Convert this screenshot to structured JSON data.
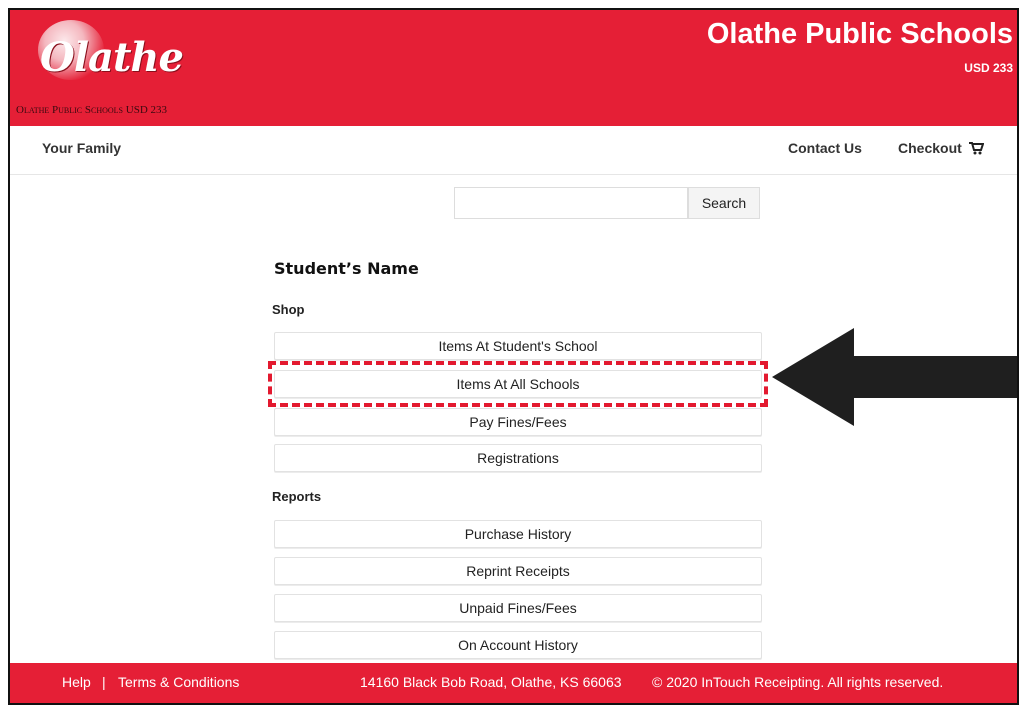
{
  "header": {
    "logo_text": "Olathe",
    "logo_subtitle": "Olathe Public Schools USD 233",
    "title": "Olathe Public Schools",
    "subtitle": "USD 233"
  },
  "nav": {
    "left": "Your Family",
    "contact": "Contact Us",
    "checkout": "Checkout"
  },
  "search": {
    "placeholder": "",
    "button": "Search"
  },
  "main": {
    "student_name": "Student’s Name",
    "shop_label": "Shop",
    "shop_items": [
      "Items At Student's School",
      "Items At All Schools",
      "Pay Fines/Fees",
      "Registrations"
    ],
    "reports_label": "Reports",
    "report_items": [
      "Purchase History",
      "Reprint Receipts",
      "Unpaid Fines/Fees",
      "On Account History"
    ]
  },
  "footer": {
    "help": "Help",
    "separator": "|",
    "terms": "Terms & Conditions",
    "address": "14160 Black Bob Road, Olathe, KS 66063",
    "copyright": "© 2020 InTouch Receipting. All rights reserved."
  },
  "colors": {
    "brand_red": "#e51f36",
    "highlight_dash": "#e3192f",
    "arrow": "#1f1f1f"
  },
  "icons": {
    "cart": "shopping-cart-icon",
    "arrow": "left-arrow-pointer-icon",
    "logo": "school-globe-logo"
  }
}
